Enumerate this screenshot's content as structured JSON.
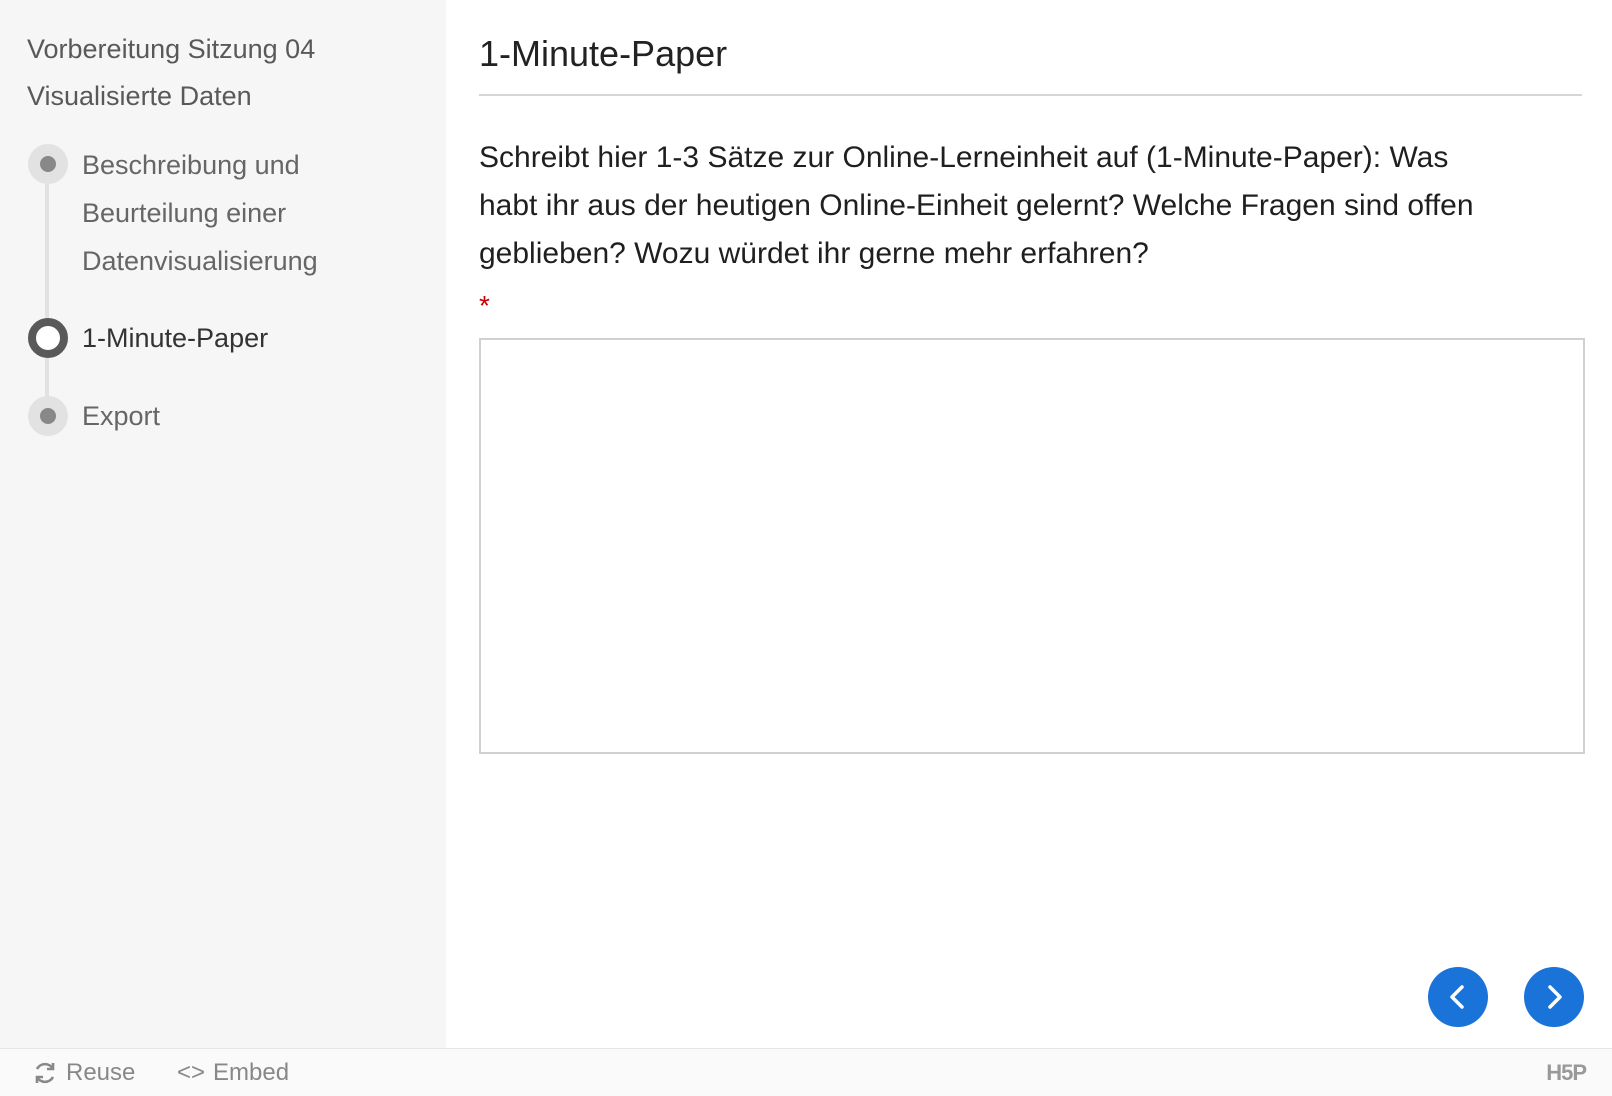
{
  "sidebar": {
    "title_line1": "Vorbereitung Sitzung 04",
    "title_line2": "Visualisierte Daten",
    "steps": [
      {
        "label_lines": [
          "Beschreibung und",
          "Beurteilung einer",
          "Datenvisualisierung"
        ],
        "state": "visited"
      },
      {
        "label_lines": [
          "1-Minute-Paper"
        ],
        "state": "current"
      },
      {
        "label_lines": [
          "Export"
        ],
        "state": "upcoming"
      }
    ]
  },
  "main": {
    "title": "1-Minute-Paper",
    "question_line1": "Schreibt hier 1-3 Sätze zur Online-Lerneinheit auf (1-Minute-Paper): Was",
    "question_line2": "habt ihr aus der heutigen Online-Einheit gelernt? Welche Fragen sind offen",
    "question_line3": "geblieben? Wozu würdet ihr gerne mehr erfahren?",
    "required_marker": "*",
    "answer_value": ""
  },
  "navigation": {
    "previous_icon": "chevron-left-icon",
    "next_icon": "chevron-right-icon",
    "button_color": "#1a73d9"
  },
  "footer": {
    "reuse_label": "Reuse",
    "embed_label": "Embed",
    "embed_icon_text": "<>",
    "logo_text": "H5P"
  }
}
